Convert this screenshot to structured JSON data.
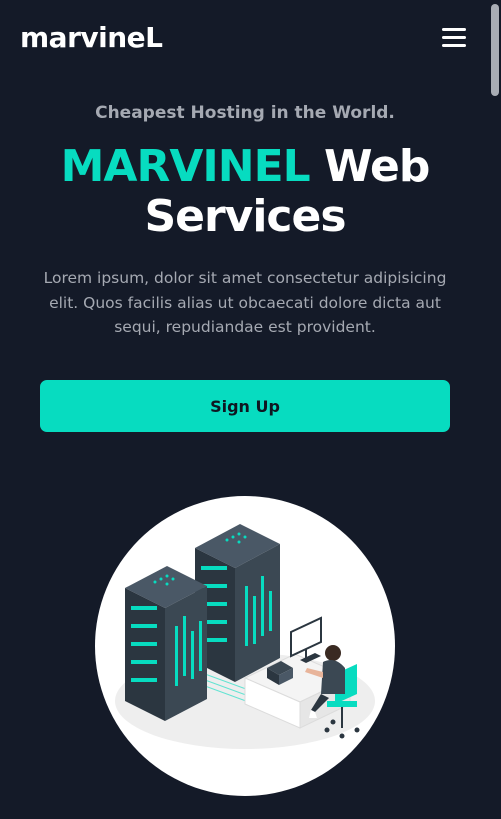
{
  "header": {
    "logo": "marvineL",
    "menu_icon": "hamburger-menu-icon"
  },
  "hero": {
    "tagline": "Cheapest Hosting in the World.",
    "title_accent": "MARVINEL",
    "title_rest_line1": "Web",
    "title_rest_line2": "Services",
    "description": "Lorem ipsum, dolor sit amet consectetur adipisicing elit. Quos facilis alias ut obcaecati dolore dicta aut sequi, repudiandae est provident.",
    "cta_label": "Sign Up"
  },
  "illustration": {
    "icon": "server-rack-person-illustration"
  },
  "colors": {
    "background": "#141a28",
    "accent": "#07dcc0",
    "muted_text": "#a5a9b2",
    "text": "#ffffff"
  }
}
